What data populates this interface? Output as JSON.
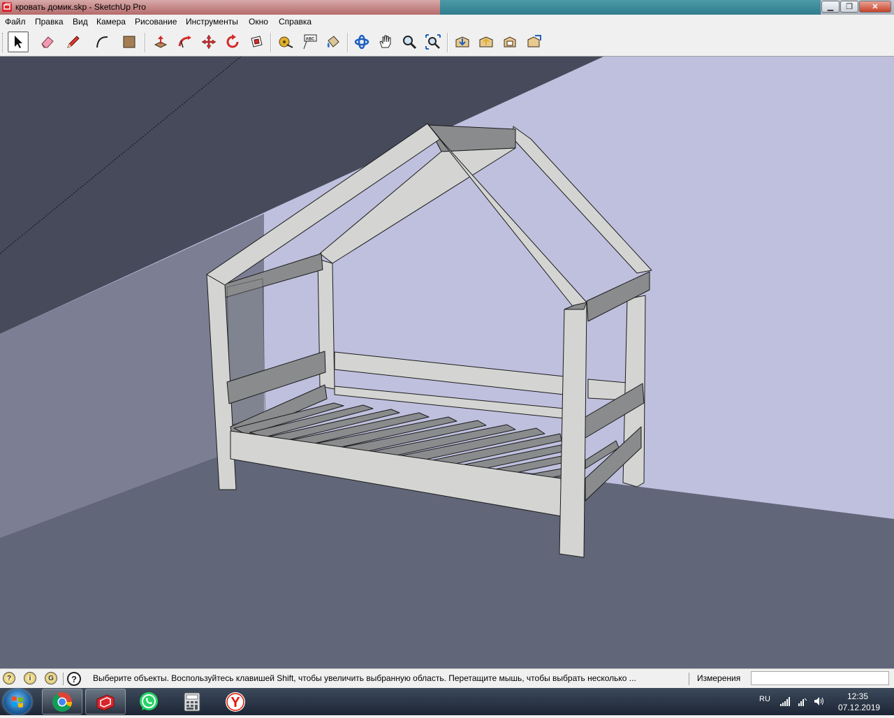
{
  "window": {
    "title": "кровать домик.skp - SketchUp Pro",
    "icon": "sketchup-logo-icon"
  },
  "menu": [
    "Файл",
    "Правка",
    "Вид",
    "Камера",
    "Рисование",
    "Инструменты",
    "Окно",
    "Справка"
  ],
  "toolbar": {
    "tools": [
      {
        "icon": "select-arrow-icon",
        "active": true
      },
      {
        "icon": "eraser-icon"
      },
      {
        "icon": "pencil-line-icon"
      },
      {
        "icon": "arc-icon"
      },
      {
        "icon": "rectangle-shape-icon"
      },
      {
        "icon": "push-pull-icon"
      },
      {
        "icon": "follow-me-icon"
      },
      {
        "icon": "move-icon"
      },
      {
        "icon": "rotate-icon"
      },
      {
        "icon": "offset-icon"
      },
      {
        "icon": "tape-measure-icon"
      },
      {
        "icon": "text-label-icon",
        "label": "ABC"
      },
      {
        "icon": "paint-bucket-icon"
      },
      {
        "icon": "orbit-icon"
      },
      {
        "icon": "pan-hand-icon"
      },
      {
        "icon": "zoom-icon"
      },
      {
        "icon": "zoom-extents-icon"
      },
      {
        "icon": "warehouse-get-models-icon"
      },
      {
        "icon": "warehouse-share-model-icon"
      },
      {
        "icon": "share-component-icon"
      },
      {
        "icon": "extension-warehouse-icon"
      }
    ]
  },
  "viewport": {
    "colors": {
      "sky_wall": "#bfc0de",
      "dark_wall": "#464a5a",
      "left_wall": "#7c7f93",
      "floor": "#626679",
      "wood_light": "#d4d5d2",
      "wood_dark": "#8a8b8d",
      "edge": "#1a1a1a"
    }
  },
  "statusbar": {
    "hint": "Выберите объекты. Воспользуйтесь клавишей Shift, чтобы увеличить выбранную область. Перетащите мышь, чтобы выбрать несколько ...",
    "measurements_label": "Измерения",
    "measurements_value": "",
    "icons": [
      "geo-location-icon",
      "credits-icon",
      "sign-in-icon",
      "help-icon"
    ]
  },
  "taskbar": {
    "apps": [
      {
        "icon": "chrome-icon"
      },
      {
        "icon": "sketchup-icon",
        "active": true
      },
      {
        "icon": "whatsapp-icon"
      },
      {
        "icon": "calculator-icon"
      },
      {
        "icon": "yandex-browser-icon",
        "label": "Y"
      }
    ],
    "lang": "RU",
    "time": "12:35",
    "date": "07.12.2019"
  }
}
